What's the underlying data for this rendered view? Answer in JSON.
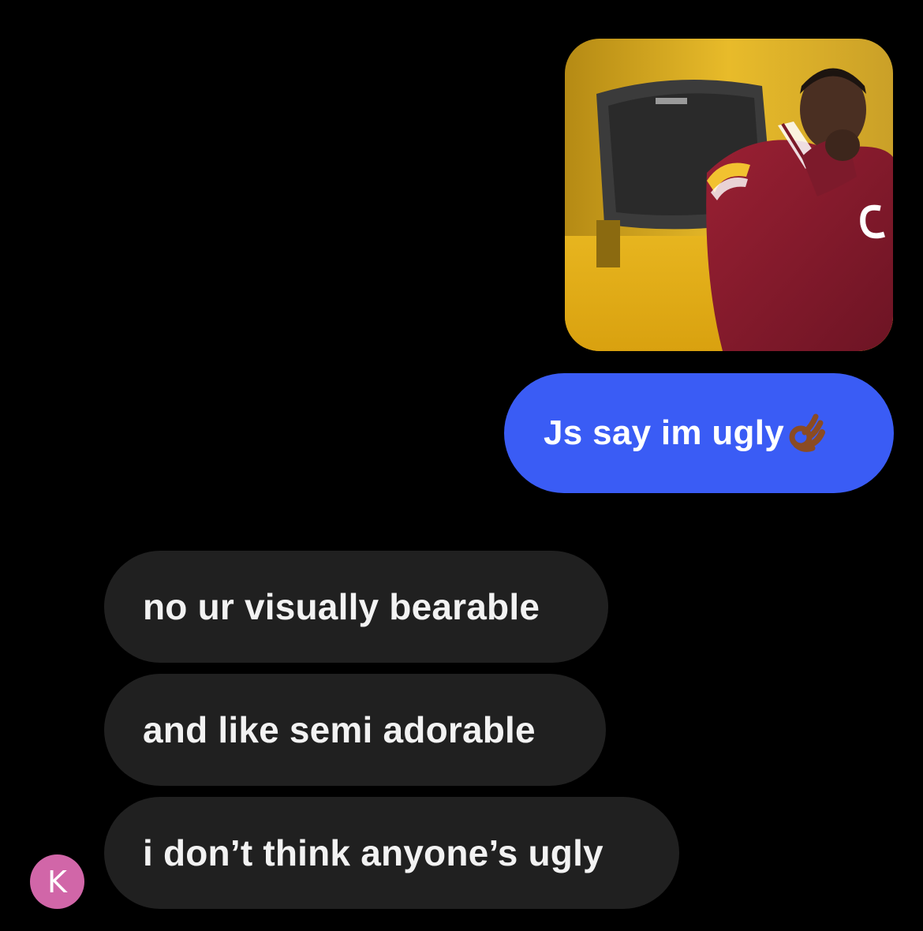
{
  "conversation": {
    "sent_image": {
      "description_icon": "photo-attachment-icon"
    },
    "sent_message": {
      "text": "Js say im ugly",
      "emoji": "ok-hand-icon"
    },
    "received_messages": [
      {
        "text": "no ur visually bearable"
      },
      {
        "text": "and like semi adorable"
      },
      {
        "text": "i don’t think anyone’s ugly"
      }
    ],
    "contact": {
      "avatar_initial": "K",
      "avatar_color": "#d166a8"
    }
  },
  "colors": {
    "background": "#000000",
    "sent_bubble": "#3a5cf5",
    "received_bubble": "#202020",
    "text": "#ffffff"
  }
}
